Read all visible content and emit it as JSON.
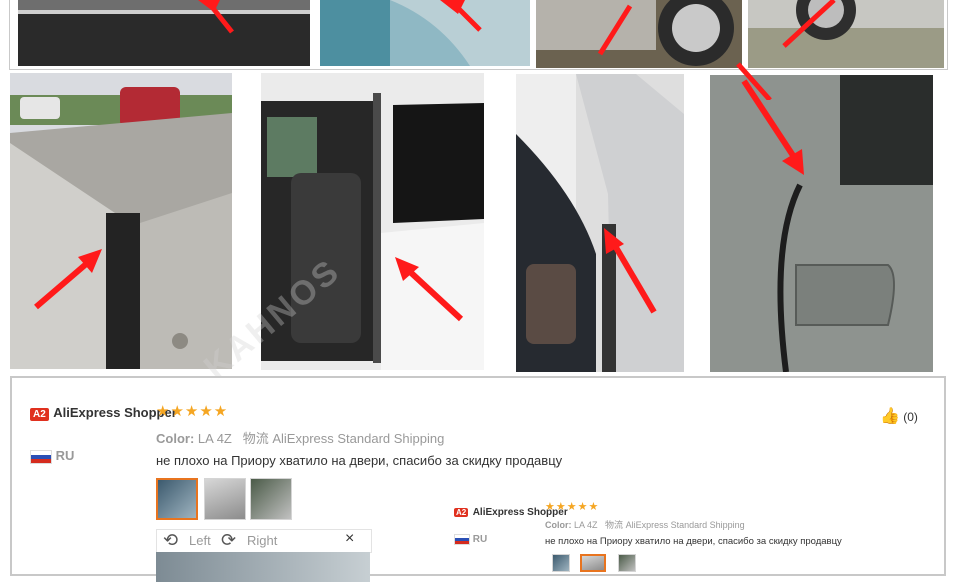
{
  "watermark": "KAHNOS",
  "review_main": {
    "badge": "A2",
    "store_name": "AliExpress Shopper",
    "country": "RU",
    "stars": "★★★★★",
    "color_label": "Color:",
    "color_value": "LA 4Z",
    "shipping_label": "物流",
    "shipping_value": "AliExpress Standard Shipping",
    "text": "не плохо на Приору хватило на двери, спасибо за скидку продавцу",
    "likes": "(0)",
    "viewer": {
      "left": "Left",
      "right": "Right",
      "close": "×"
    }
  },
  "review_small": {
    "badge": "A2",
    "store_name": "AliExpress Shopper",
    "country": "RU",
    "stars": "★★★★★",
    "color_label": "Color:",
    "color_value": "LA 4Z",
    "shipping_label": "物流",
    "shipping_value": "AliExpress Standard Shipping",
    "text": "не плохо на Приору хватило на двери, спасибо за скидку продавцу"
  },
  "colors": {
    "accent": "#e0311f",
    "star": "#f5a623",
    "arrow": "#ff1a1a",
    "thumb_active": "#e8741f"
  }
}
